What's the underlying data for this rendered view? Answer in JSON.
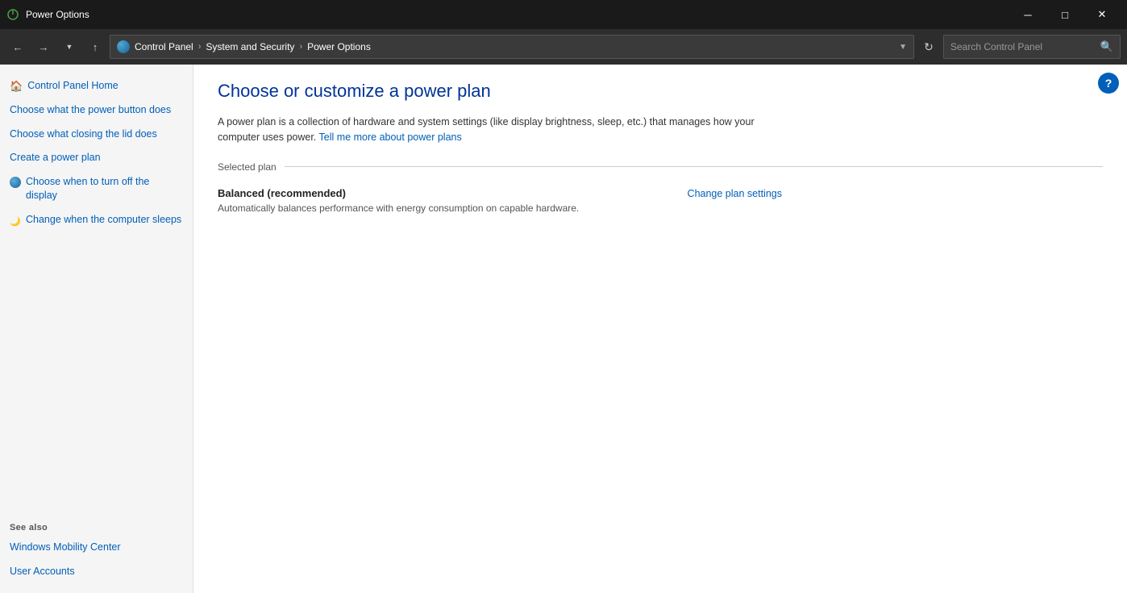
{
  "titlebar": {
    "icon_alt": "power-options-icon",
    "title": "Power Options",
    "minimize_label": "─",
    "maximize_label": "□",
    "close_label": "✕"
  },
  "navbar": {
    "back_tooltip": "Back",
    "forward_tooltip": "Forward",
    "recent_tooltip": "Recent locations",
    "up_tooltip": "Up",
    "address": {
      "breadcrumb_1": "Control Panel",
      "sep1": "›",
      "breadcrumb_2": "System and Security",
      "sep2": "›",
      "breadcrumb_3": "Power Options"
    },
    "refresh_symbol": "↻",
    "search_placeholder": "Search Control Panel",
    "search_icon": "🔍"
  },
  "sidebar": {
    "nav_links": [
      {
        "id": "control-panel-home",
        "label": "Control Panel Home",
        "icon": "home"
      },
      {
        "id": "power-button",
        "label": "Choose what the power button does",
        "icon": "none"
      },
      {
        "id": "lid",
        "label": "Choose what closing the lid does",
        "icon": "none"
      },
      {
        "id": "create-plan",
        "label": "Create a power plan",
        "icon": "none"
      },
      {
        "id": "turn-off-display",
        "label": "Choose when to turn off the display",
        "icon": "globe"
      },
      {
        "id": "sleep",
        "label": "Change when the computer sleeps",
        "icon": "moon"
      }
    ],
    "see_also_title": "See also",
    "see_also_links": [
      {
        "id": "mobility-center",
        "label": "Windows Mobility Center"
      },
      {
        "id": "user-accounts",
        "label": "User Accounts"
      }
    ]
  },
  "content": {
    "page_title": "Choose or customize a power plan",
    "description_text": "A power plan is a collection of hardware and system settings (like display brightness, sleep, etc.) that manages how your computer uses power.",
    "description_link_text": "Tell me more about power plans",
    "selected_plan_label": "Selected plan",
    "plan": {
      "name": "Balanced (recommended)",
      "description": "Automatically balances performance with energy consumption on capable hardware.",
      "action_label": "Change plan settings"
    }
  },
  "help": {
    "label": "?"
  }
}
